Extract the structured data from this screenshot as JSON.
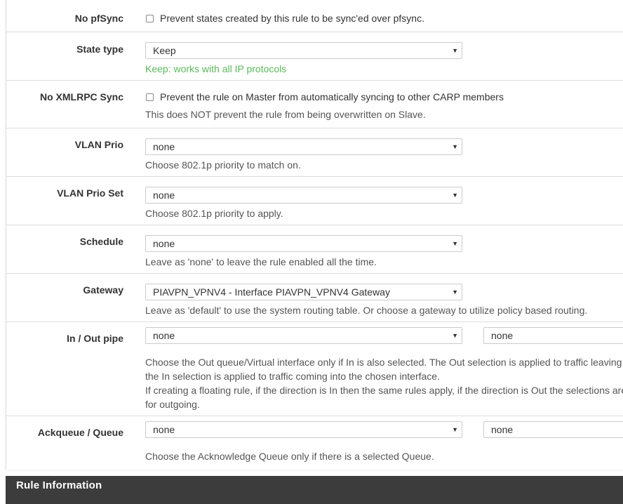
{
  "rows": {
    "no_pfsync": {
      "label": "No pfSync",
      "checkbox_label": "Prevent states created by this rule to be sync'ed over pfsync."
    },
    "state_type": {
      "label": "State type",
      "value": "Keep",
      "help": "Keep: works with all IP protocols"
    },
    "no_xmlrpc_sync": {
      "label": "No XMLRPC Sync",
      "checkbox_label": "Prevent the rule on Master from automatically syncing to other CARP members",
      "help": "This does NOT prevent the rule from being overwritten on Slave."
    },
    "vlan_prio": {
      "label": "VLAN Prio",
      "value": "none",
      "help": "Choose 802.1p priority to match on."
    },
    "vlan_prio_set": {
      "label": "VLAN Prio Set",
      "value": "none",
      "help": "Choose 802.1p priority to apply."
    },
    "schedule": {
      "label": "Schedule",
      "value": "none",
      "help": "Leave as 'none' to leave the rule enabled all the time."
    },
    "gateway": {
      "label": "Gateway",
      "value": "PIAVPN_VPNV4 - Interface PIAVPN_VPNV4 Gateway",
      "help": "Leave as 'default' to use the system routing table. Or choose a gateway to utilize policy based routing."
    },
    "in_out_pipe": {
      "label": "In / Out pipe",
      "in_value": "none",
      "out_value": "none",
      "help_line1": "Choose the Out queue/Virtual interface only if In is also selected. The Out selection is applied to traffic leaving",
      "help_line2": "the In selection is applied to traffic coming into the chosen interface.",
      "help_line3": "If creating a floating rule, if the direction is In then the same rules apply, if the direction is Out the selections are",
      "help_line4": "for outgoing."
    },
    "ackqueue_queue": {
      "label": "Ackqueue / Queue",
      "ack_value": "none",
      "queue_value": "none",
      "help": "Choose the Acknowledge Queue only if there is a selected Queue."
    }
  },
  "section": {
    "title": "Rule Information"
  },
  "colors": {
    "help_green": "#5cb85c",
    "section_bar": "#3c3c3c",
    "border": "#dddddd"
  },
  "icons": {
    "select_arrow": "caret-down-icon"
  }
}
